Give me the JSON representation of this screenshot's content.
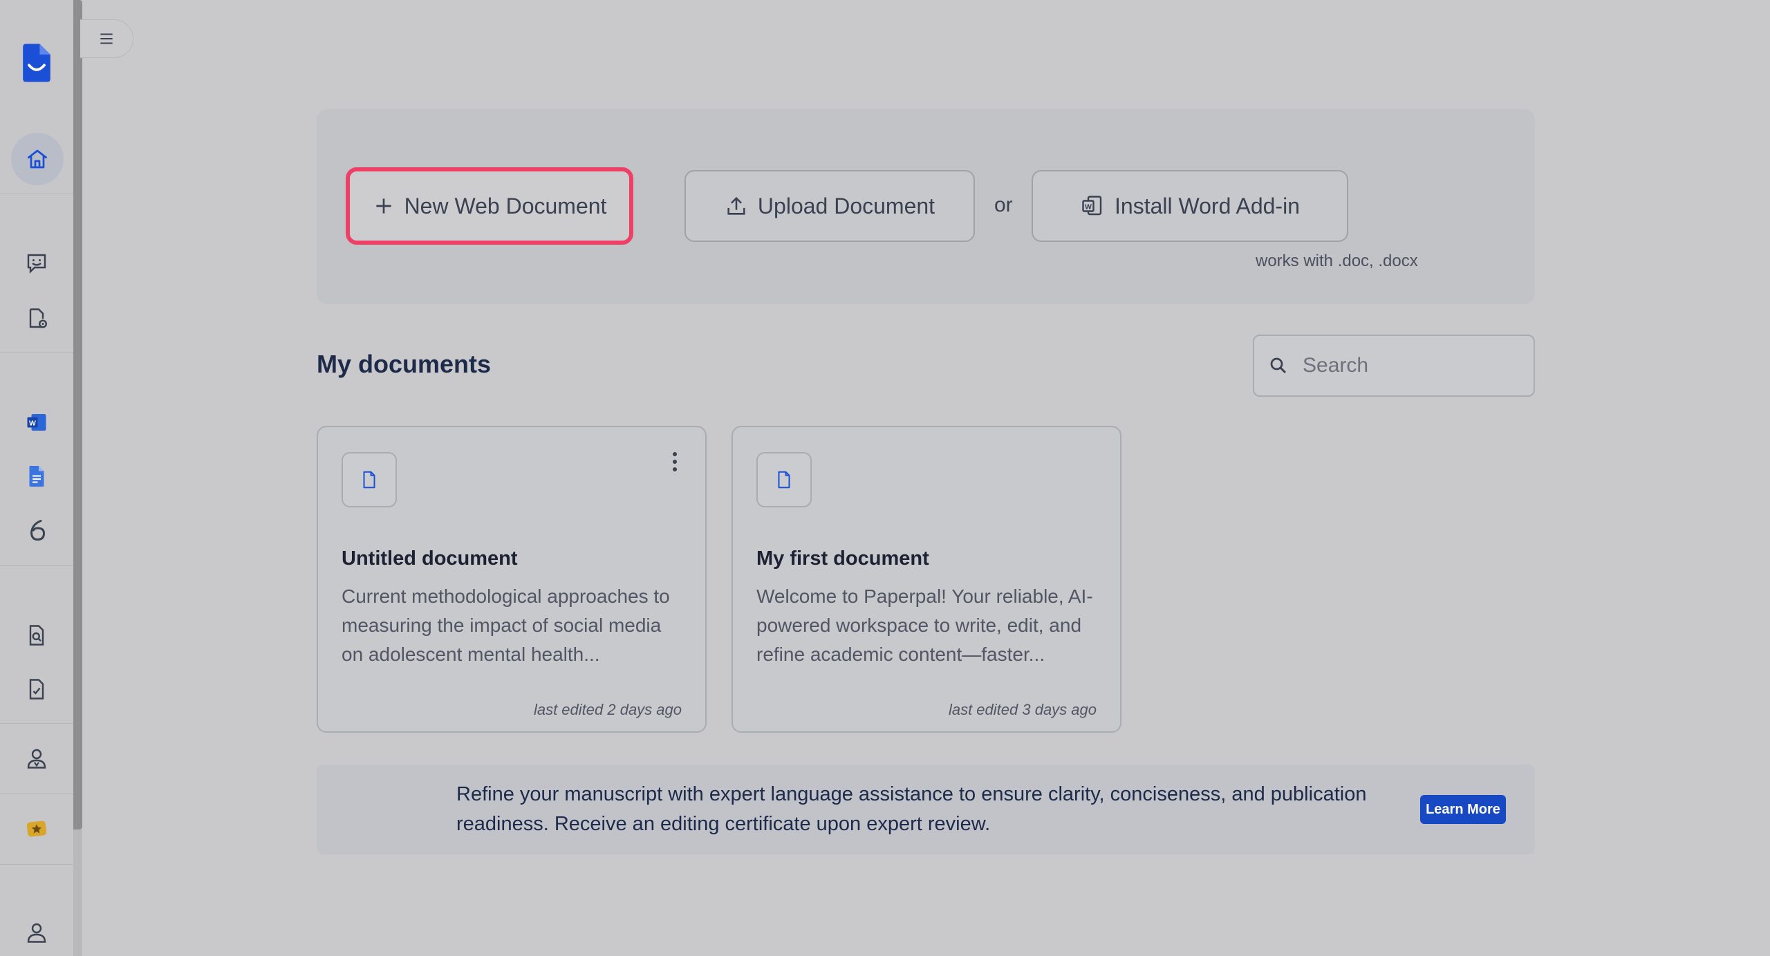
{
  "app": {
    "brand_color": "#1a4fd6",
    "accent_highlight": "#ee3f66"
  },
  "sidebar": {
    "items": [
      {
        "icon": "logo-icon"
      },
      {
        "icon": "home-icon",
        "active": true
      },
      {
        "icon": "chat-feedback-icon"
      },
      {
        "icon": "document-settings-icon"
      },
      {
        "icon": "word-icon"
      },
      {
        "icon": "google-docs-icon"
      },
      {
        "icon": "overleaf-icon"
      },
      {
        "icon": "document-search-icon"
      },
      {
        "icon": "document-check-icon"
      },
      {
        "icon": "expert-user-icon"
      },
      {
        "icon": "premium-star-icon"
      },
      {
        "icon": "user-profile-icon"
      }
    ]
  },
  "actions": {
    "new_doc_label": "New Web Document",
    "upload_label": "Upload Document",
    "or_label": "or",
    "install_label": "Install Word Add-in",
    "works_with": "works with .doc, .docx"
  },
  "documents": {
    "title": "My documents",
    "search_placeholder": "Search",
    "items": [
      {
        "title": "Untitled document",
        "excerpt": "Current methodological approaches to measuring the impact of social media on adolescent mental health...",
        "edited": "last edited 2 days ago"
      },
      {
        "title": "My first document",
        "excerpt": "Welcome to Paperpal! Your reliable, AI-powered workspace to write, edit, and refine academic content—faster...",
        "edited": "last edited 3 days ago"
      }
    ]
  },
  "banner": {
    "text": "Refine your manuscript with expert language assistance to ensure clarity, conciseness, and publication readiness. Receive an editing certificate upon expert review.",
    "button_label": "Learn More"
  }
}
